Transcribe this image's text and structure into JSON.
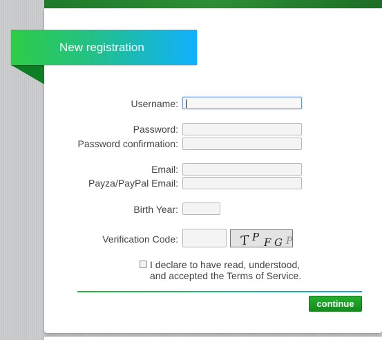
{
  "header": {
    "title": "New registration"
  },
  "form": {
    "username_label": "Username:",
    "password_label": "Password:",
    "password_confirmation_label": "Password confirmation:",
    "email_label": "Email:",
    "payza_label": "Payza/PayPal Email:",
    "birth_year_label": "Birth Year:",
    "verification_label": "Verification Code:",
    "captcha_chars": [
      "T",
      "P",
      "F",
      "G",
      "P"
    ],
    "terms_line1": "I declare to have read, understood,",
    "terms_line2": "and accepted the Terms of Service.",
    "continue_label": "continue"
  },
  "colors": {
    "ribbon_start": "#2ecc46",
    "ribbon_end": "#10b0ff",
    "button": "#1b9a24",
    "top_bar": "#2c8f35"
  }
}
